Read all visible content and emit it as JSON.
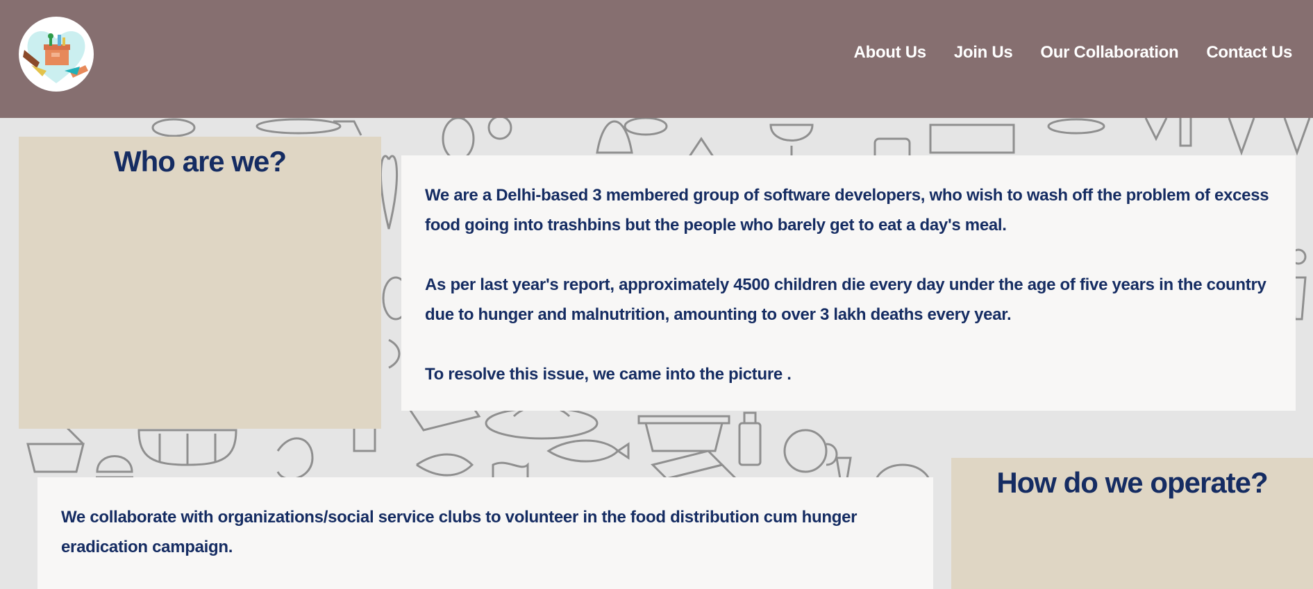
{
  "nav": {
    "items": [
      "About Us",
      "Join Us",
      "Our Collaboration",
      "Contact Us"
    ]
  },
  "logo": {
    "icon": "donation-box-hands-icon"
  },
  "who": {
    "heading": "Who are we?",
    "paragraphs": [
      "We are a Delhi-based 3 membered group of software developers, who wish to wash off the problem of excess food going into trashbins but the people who barely get to eat a day's meal.",
      "As per last year's report, approximately 4500 children die every day under the age of five years in the country due to hunger and malnutrition, amounting to over 3 lakh deaths every year.",
      "To resolve this issue, we came into the picture ."
    ]
  },
  "how": {
    "heading": "How do we operate?",
    "paragraphs": [
      "We collaborate with organizations/social service clubs to volunteer in the food distribution cum hunger eradication campaign."
    ]
  },
  "colors": {
    "header": "#866f70",
    "tan_card": "#dfd6c4",
    "white_card": "#f8f7f6",
    "text": "#152c62",
    "background": "#e5e5e5"
  }
}
